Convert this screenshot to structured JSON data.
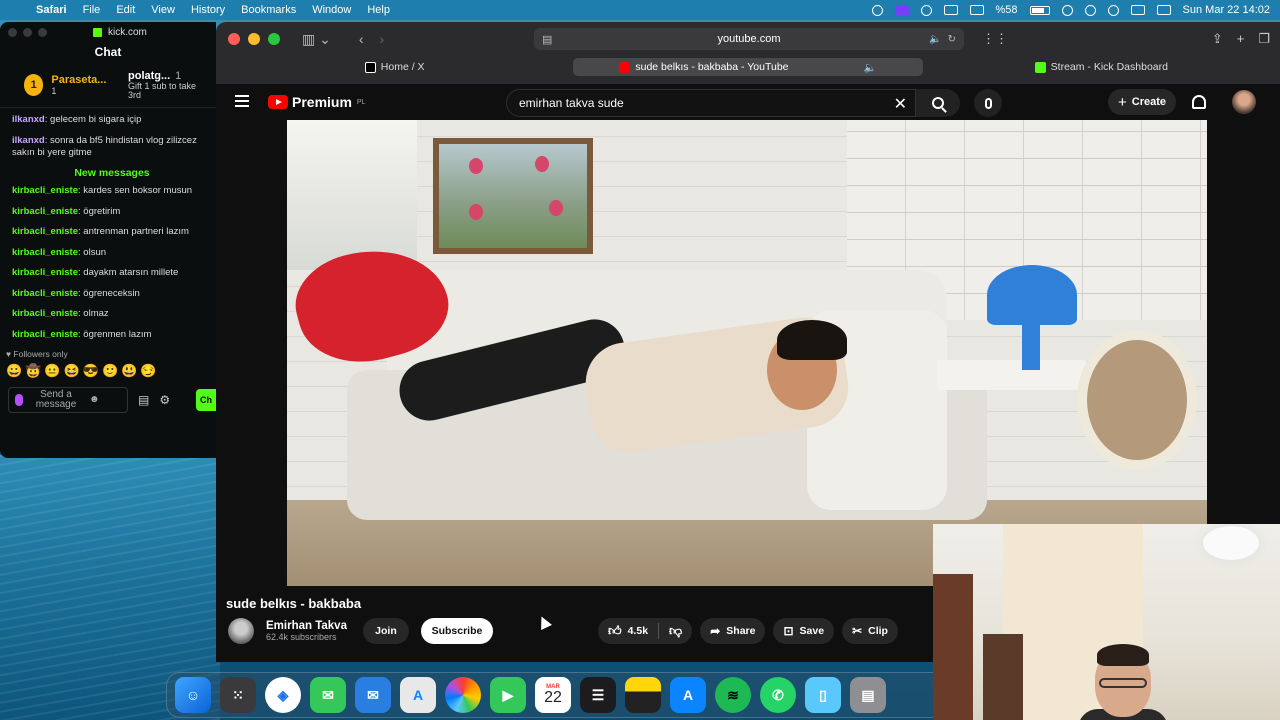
{
  "menubar": {
    "app": "Safari",
    "items": [
      "File",
      "Edit",
      "View",
      "History",
      "Bookmarks",
      "Window",
      "Help"
    ],
    "battery": "%58",
    "datetime": "Sun Mar 22  14:02"
  },
  "kick": {
    "url": "kick.com",
    "chat_title": "Chat",
    "gifters": [
      {
        "rank": "1",
        "name": "Paraseta...",
        "count": "1"
      },
      {
        "name": "polatg...",
        "count": "1",
        "sub": "Gift 1 sub to take 3rd"
      }
    ],
    "messages_before": [
      {
        "user": "ilkanxd",
        "text": "gelecem bi sigara içip"
      },
      {
        "user": "ilkanxd",
        "text": "sonra da bf5 hindistan vlog zilizcez sakın bi yere gitme"
      }
    ],
    "new_messages_label": "New messages",
    "messages_after": [
      {
        "user": "kirbacli_eniste",
        "text": "kardes sen boksor musun"
      },
      {
        "user": "kirbacli_eniste",
        "text": "ögretirim"
      },
      {
        "user": "kirbacli_eniste",
        "text": "antrenman partneri lazım"
      },
      {
        "user": "kirbacli_eniste",
        "text": "olsun"
      },
      {
        "user": "kirbacli_eniste",
        "text": "dayakm atarsın millete"
      },
      {
        "user": "kirbacli_eniste",
        "text": "ögreneceksin"
      },
      {
        "user": "kirbacli_eniste",
        "text": "olmaz"
      },
      {
        "user": "kirbacli_eniste",
        "text": "ögrenmen lazım"
      }
    ],
    "followers_only": "Followers only",
    "send_placeholder": "Send a message",
    "chat_button": "Ch"
  },
  "safari": {
    "address": "youtube.com",
    "tabs": [
      {
        "label": "Home / X",
        "icon": "x-icon"
      },
      {
        "label": "sude belkıs - bakbaba - YouTube",
        "icon": "youtube-icon"
      },
      {
        "label": "Stream - Kick Dashboard",
        "icon": "kick-icon"
      }
    ]
  },
  "youtube": {
    "logo_text": "Premium",
    "logo_region": "PL",
    "search_value": "emirhan takva sude",
    "create_label": "Create",
    "video_title": "sude belkıs - bakbaba",
    "channel_name": "Emirhan Takva",
    "channel_subs": "62.4k subscribers",
    "join_label": "Join",
    "subscribe_label": "Subscribe",
    "like_count": "4.5k",
    "share_label": "Share",
    "save_label": "Save",
    "clip_label": "Clip"
  },
  "dock": {
    "calendar_month": "MAR",
    "calendar_day": "22"
  }
}
